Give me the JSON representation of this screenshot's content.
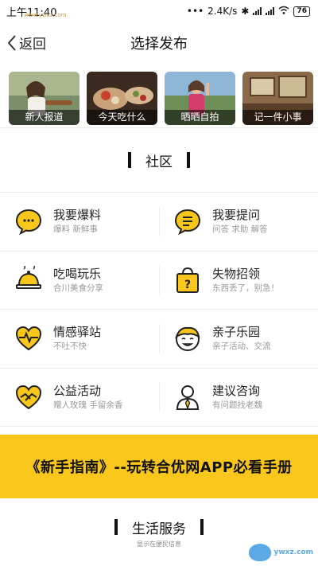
{
  "status": {
    "time": "上午11:40",
    "speed": "2.4K/s",
    "battery": "76",
    "watermark": "www.ywxz.com"
  },
  "header": {
    "back_label": "返回",
    "title": "选择发布"
  },
  "tiles": [
    {
      "label": "新人报道"
    },
    {
      "label": "今天吃什么"
    },
    {
      "label": "晒晒自拍"
    },
    {
      "label": "记一件小事"
    }
  ],
  "community": {
    "title": "社区",
    "items": [
      {
        "name": "我要爆料",
        "desc": "爆料 新鲜事",
        "icon": "chat-bubble-icon"
      },
      {
        "name": "我要提问",
        "desc": "问答 求助 解答",
        "icon": "question-bubble-icon"
      },
      {
        "name": "吃喝玩乐",
        "desc": "合川美食分享",
        "icon": "food-cloche-icon"
      },
      {
        "name": "失物招领",
        "desc": "东西丢了，别急！",
        "icon": "lost-bag-icon"
      },
      {
        "name": "情感驿站",
        "desc": "不吐不快",
        "icon": "heart-pulse-icon"
      },
      {
        "name": "亲子乐园",
        "desc": "亲子活动、交流",
        "icon": "child-face-icon"
      },
      {
        "name": "公益活动",
        "desc": "赠人玫瑰 手留余香",
        "icon": "charity-heart-icon"
      },
      {
        "name": "建议咨询",
        "desc": "有问题找老魏",
        "icon": "advisor-person-icon"
      }
    ]
  },
  "guide": {
    "text": "《新手指南》--玩转合优网APP必看手册"
  },
  "life": {
    "title": "生活服务",
    "subtitle": "显示在便民信息"
  },
  "logo": {
    "text": "ywxz.com"
  },
  "colors": {
    "accent": "#f9c71b",
    "text": "#222222",
    "muted": "#999999"
  }
}
